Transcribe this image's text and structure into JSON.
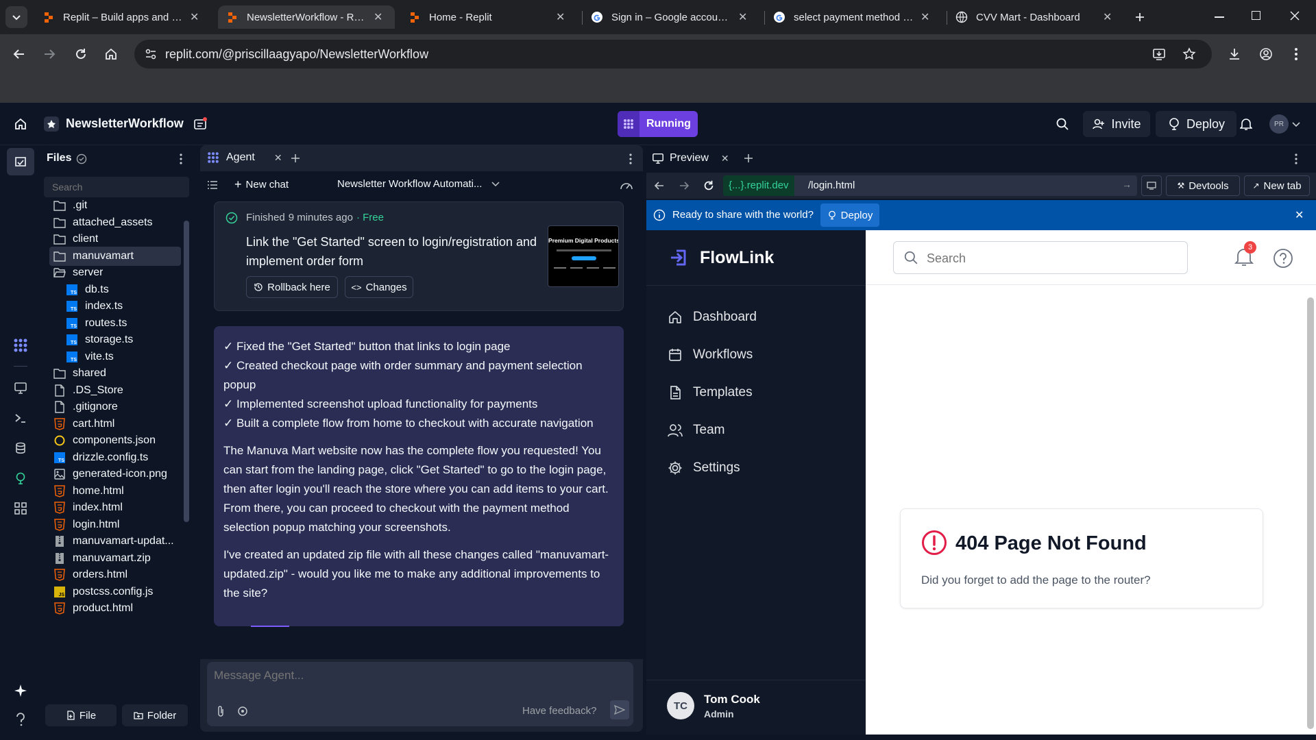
{
  "browser": {
    "tabs": [
      {
        "title": "Replit – Build apps and sites",
        "active": false
      },
      {
        "title": "NewsletterWorkflow - Replit",
        "active": true
      },
      {
        "title": "Home - Replit",
        "active": false
      },
      {
        "title": "Sign in – Google accounts",
        "active": false
      },
      {
        "title": "select payment method for",
        "active": false
      },
      {
        "title": "CVV Mart - Dashboard",
        "active": false
      }
    ],
    "url": "replit.com/@priscillaagyapo/NewsletterWorkflow"
  },
  "header": {
    "project_name": "NewsletterWorkflow",
    "run_status": "Running",
    "invite": "Invite",
    "deploy": "Deploy",
    "avatar": "PR"
  },
  "files": {
    "title": "Files",
    "search_placeholder": "Search",
    "items": [
      {
        "name": ".git",
        "type": "folder",
        "indent": 0
      },
      {
        "name": "attached_assets",
        "type": "folder",
        "indent": 0
      },
      {
        "name": "client",
        "type": "folder",
        "indent": 0
      },
      {
        "name": "manuvamart",
        "type": "folder",
        "indent": 0,
        "selected": true
      },
      {
        "name": "server",
        "type": "folder-open",
        "indent": 0
      },
      {
        "name": "db.ts",
        "type": "ts",
        "indent": 1
      },
      {
        "name": "index.ts",
        "type": "ts",
        "indent": 1
      },
      {
        "name": "routes.ts",
        "type": "ts",
        "indent": 1
      },
      {
        "name": "storage.ts",
        "type": "ts",
        "indent": 1
      },
      {
        "name": "vite.ts",
        "type": "ts",
        "indent": 1
      },
      {
        "name": "shared",
        "type": "folder",
        "indent": 0
      },
      {
        "name": ".DS_Store",
        "type": "file",
        "indent": 0
      },
      {
        "name": ".gitignore",
        "type": "file",
        "indent": 0
      },
      {
        "name": "cart.html",
        "type": "html",
        "indent": 0
      },
      {
        "name": "components.json",
        "type": "json",
        "indent": 0
      },
      {
        "name": "drizzle.config.ts",
        "type": "ts",
        "indent": 0
      },
      {
        "name": "generated-icon.png",
        "type": "image",
        "indent": 0
      },
      {
        "name": "home.html",
        "type": "html",
        "indent": 0
      },
      {
        "name": "index.html",
        "type": "html",
        "indent": 0
      },
      {
        "name": "login.html",
        "type": "html",
        "indent": 0
      },
      {
        "name": "manuvamart-updat...",
        "type": "zip",
        "indent": 0
      },
      {
        "name": "manuvamart.zip",
        "type": "zip",
        "indent": 0
      },
      {
        "name": "orders.html",
        "type": "html",
        "indent": 0
      },
      {
        "name": "postcss.config.js",
        "type": "js",
        "indent": 0
      },
      {
        "name": "product.html",
        "type": "html",
        "indent": 0
      }
    ],
    "new_file": "File",
    "new_folder": "Folder"
  },
  "agent": {
    "tab": "Agent",
    "new_chat": "New chat",
    "chat_title": "Newsletter Workflow Automati...",
    "status": "Finished",
    "time": "9 minutes ago",
    "price": "· Free",
    "task": "Link the \"Get Started\" screen to login/registration and implement order form",
    "thumb_text": "Premium Digital Products",
    "rollback": "Rollback here",
    "changes": "Changes",
    "checklist": [
      "✓ Fixed the \"Get Started\" button that links to login page",
      "✓ Created checkout page with order summary and payment selection popup",
      "✓ Implemented screenshot upload functionality for payments",
      "✓ Built a complete flow from home to checkout with accurate navigation"
    ],
    "para1": "The Manuva Mart website now has the complete flow you requested! You can start from the landing page, click \"Get Started\" to go to the login page, then after login you'll reach the store where you can add items to your cart. From there, you can proceed to checkout with the payment method selection popup matching your screenshots.",
    "para2": "I've created an updated zip file with all these changes called \"manuvamart-updated.zip\" - would you like me to make any additional improvements to the site?",
    "input_placeholder": "Message Agent...",
    "feedback": "Have feedback?"
  },
  "preview": {
    "tab": "Preview",
    "domain": "{...}.replit.dev",
    "path": "/login.html",
    "devtools": "Devtools",
    "new_tab": "New tab",
    "banner": "Ready to share with the world?",
    "banner_deploy": "Deploy",
    "app": {
      "brand": "FlowLink",
      "search_placeholder": "Search",
      "notif_count": "3",
      "nav": [
        {
          "label": "Dashboard",
          "icon": "home-icon"
        },
        {
          "label": "Workflows",
          "icon": "calendar-icon"
        },
        {
          "label": "Templates",
          "icon": "document-icon"
        },
        {
          "label": "Team",
          "icon": "users-icon"
        },
        {
          "label": "Settings",
          "icon": "gear-icon"
        }
      ],
      "user": {
        "initials": "TC",
        "name": "Tom Cook",
        "role": "Admin"
      },
      "error_title": "404 Page Not Found",
      "error_msg": "Did you forget to add the page to the router?"
    }
  },
  "colors": {
    "bg": "#0e1525",
    "panel": "#1c2333",
    "accent": "#7c5cff",
    "running": "#6b3fe0",
    "banner": "#0053a6",
    "error": "#e11d48"
  }
}
